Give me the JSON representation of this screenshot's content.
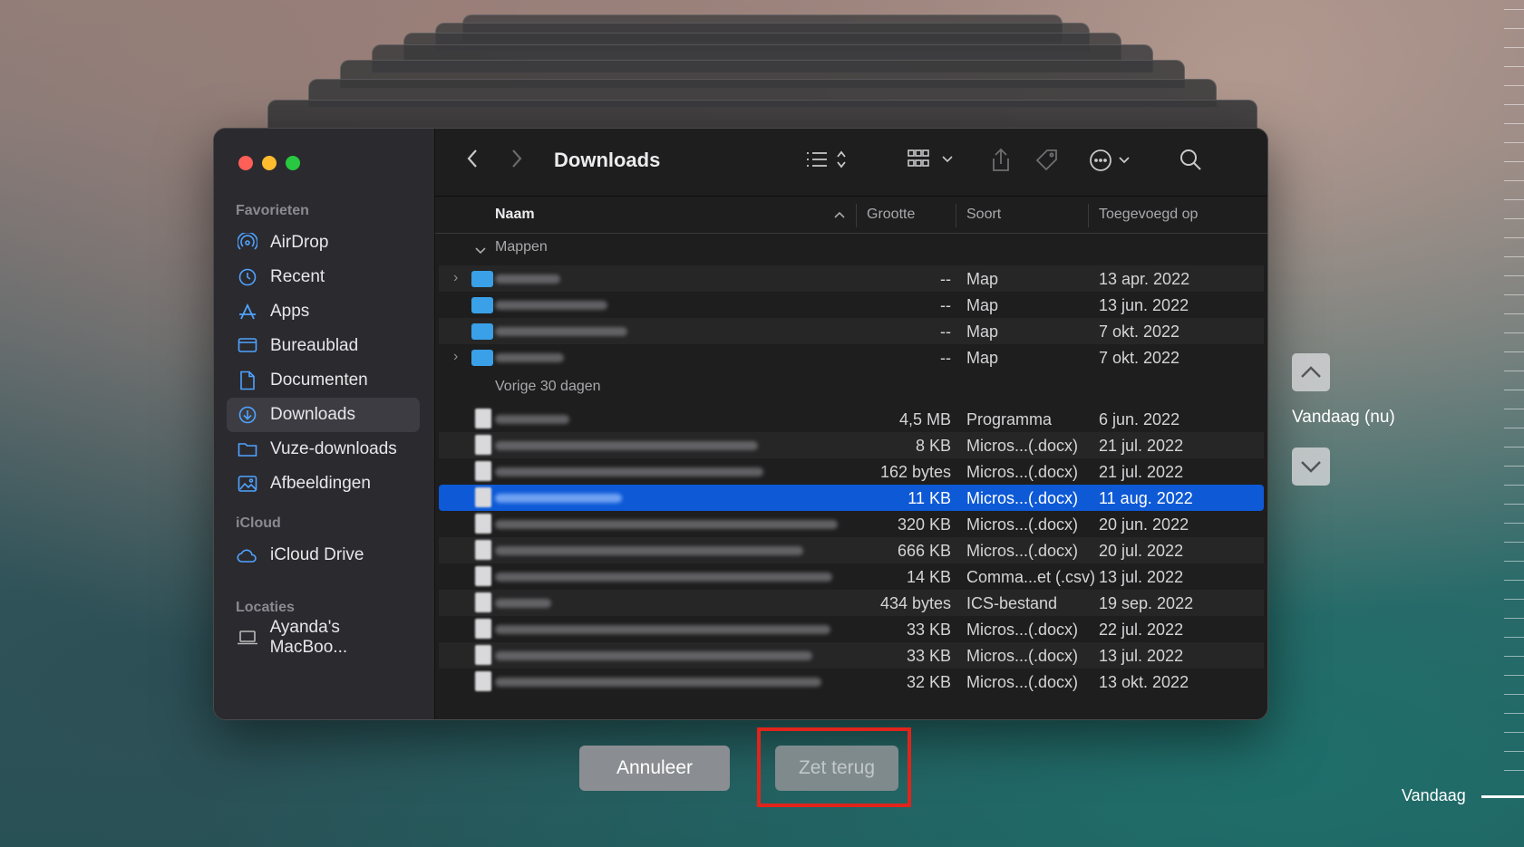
{
  "window": {
    "title": "Downloads"
  },
  "sidebar": {
    "sections": [
      {
        "title": "Favorieten",
        "items": [
          {
            "label": "AirDrop",
            "icon": "airdrop-icon"
          },
          {
            "label": "Recent",
            "icon": "clock-icon"
          },
          {
            "label": "Apps",
            "icon": "apps-icon"
          },
          {
            "label": "Bureaublad",
            "icon": "desktop-icon"
          },
          {
            "label": "Documenten",
            "icon": "document-icon"
          },
          {
            "label": "Downloads",
            "icon": "download-icon",
            "active": true
          },
          {
            "label": "Vuze-downloads",
            "icon": "folder-icon"
          },
          {
            "label": "Afbeeldingen",
            "icon": "image-icon"
          }
        ]
      },
      {
        "title": "iCloud",
        "items": [
          {
            "label": "iCloud Drive",
            "icon": "cloud-icon"
          }
        ]
      },
      {
        "title": "Locaties",
        "items": [
          {
            "label": "Ayanda's MacBoo...",
            "icon": "laptop-icon"
          }
        ]
      }
    ]
  },
  "columns": {
    "name": "Naam",
    "size": "Grootte",
    "kind": "Soort",
    "added": "Toegevoegd op"
  },
  "groups": {
    "folders": "Mappen",
    "recent": "Vorige 30 dagen"
  },
  "folder_rows": [
    {
      "size": "--",
      "kind": "Map",
      "added": "13 apr. 2022",
      "expandable": true
    },
    {
      "size": "--",
      "kind": "Map",
      "added": "13 jun. 2022",
      "expandable": false
    },
    {
      "size": "--",
      "kind": "Map",
      "added": "7 okt. 2022",
      "expandable": false
    },
    {
      "size": "--",
      "kind": "Map",
      "added": "7 okt. 2022",
      "expandable": true
    }
  ],
  "file_rows": [
    {
      "size": "4,5 MB",
      "kind": "Programma",
      "added": "6 jun. 2022"
    },
    {
      "size": "8 KB",
      "kind": "Micros...(.docx)",
      "added": "21 jul. 2022"
    },
    {
      "size": "162 bytes",
      "kind": "Micros...(.docx)",
      "added": "21 jul. 2022"
    },
    {
      "size": "11 KB",
      "kind": "Micros...(.docx)",
      "added": "11 aug. 2022",
      "selected": true
    },
    {
      "size": "320 KB",
      "kind": "Micros...(.docx)",
      "added": "20 jun. 2022"
    },
    {
      "size": "666 KB",
      "kind": "Micros...(.docx)",
      "added": "20 jul. 2022"
    },
    {
      "size": "14 KB",
      "kind": "Comma...et (.csv)",
      "added": "13 jul. 2022"
    },
    {
      "size": "434 bytes",
      "kind": "ICS-bestand",
      "added": "19 sep. 2022"
    },
    {
      "size": "33 KB",
      "kind": "Micros...(.docx)",
      "added": "22 jul. 2022"
    },
    {
      "size": "33 KB",
      "kind": "Micros...(.docx)",
      "added": "13 jul. 2022"
    },
    {
      "size": "32 KB",
      "kind": "Micros...(.docx)",
      "added": "13 okt. 2022"
    }
  ],
  "buttons": {
    "cancel": "Annuleer",
    "restore": "Zet terug"
  },
  "timeline": {
    "current": "Vandaag (nu)",
    "bottom": "Vandaag"
  },
  "colors": {
    "selection": "#0d59d6",
    "highlight_box": "#e0241b",
    "accent": "#4fa3ff"
  }
}
